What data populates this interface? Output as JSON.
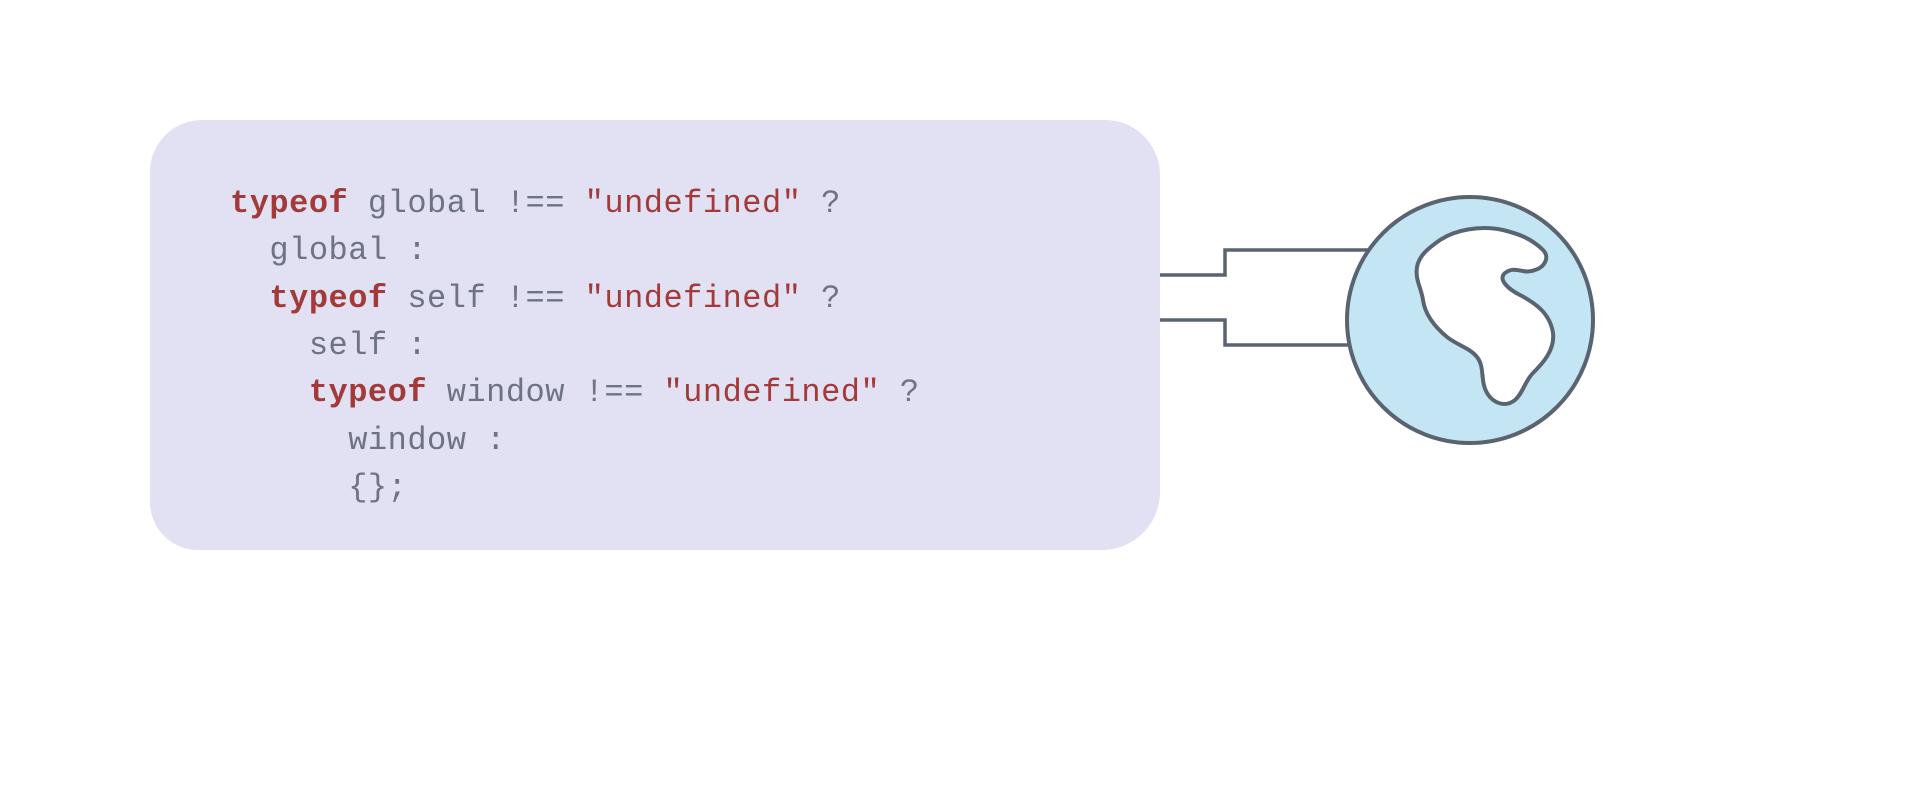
{
  "code": {
    "line1": {
      "kw": "typeof",
      "sp1": " ",
      "id": "global",
      "sp2": " ",
      "op1": "!==",
      "sp3": " ",
      "str": "\"undefined\"",
      "sp4": " ",
      "op2": "?"
    },
    "line2": {
      "indent": "  ",
      "id": "global",
      "sp": " ",
      "op": ":"
    },
    "line3": {
      "indent": "  ",
      "kw": "typeof",
      "sp1": " ",
      "id": "self",
      "sp2": " ",
      "op1": "!==",
      "sp3": " ",
      "str": "\"undefined\"",
      "sp4": " ",
      "op2": "?"
    },
    "line4": {
      "indent": "    ",
      "id": "self",
      "sp": " ",
      "op": ":"
    },
    "line5": {
      "indent": "    ",
      "kw": "typeof",
      "sp1": " ",
      "id": "window",
      "sp2": " ",
      "op1": "!==",
      "sp3": " ",
      "str": "\"undefined\"",
      "sp4": " ",
      "op2": "?"
    },
    "line6": {
      "indent": "      ",
      "id": "window",
      "sp": " ",
      "op": ":"
    },
    "line7": {
      "indent": "      ",
      "op": "{};"
    }
  },
  "icons": {
    "globe": "globe-icon"
  },
  "colors": {
    "cardBg": "#e2e0f3",
    "keyword": "#a23a3a",
    "string": "#a23a3a",
    "identifier": "#6d7380",
    "connector": "#5a6470",
    "globeFill": "#c4e5f4",
    "globeStroke": "#5a6470"
  }
}
